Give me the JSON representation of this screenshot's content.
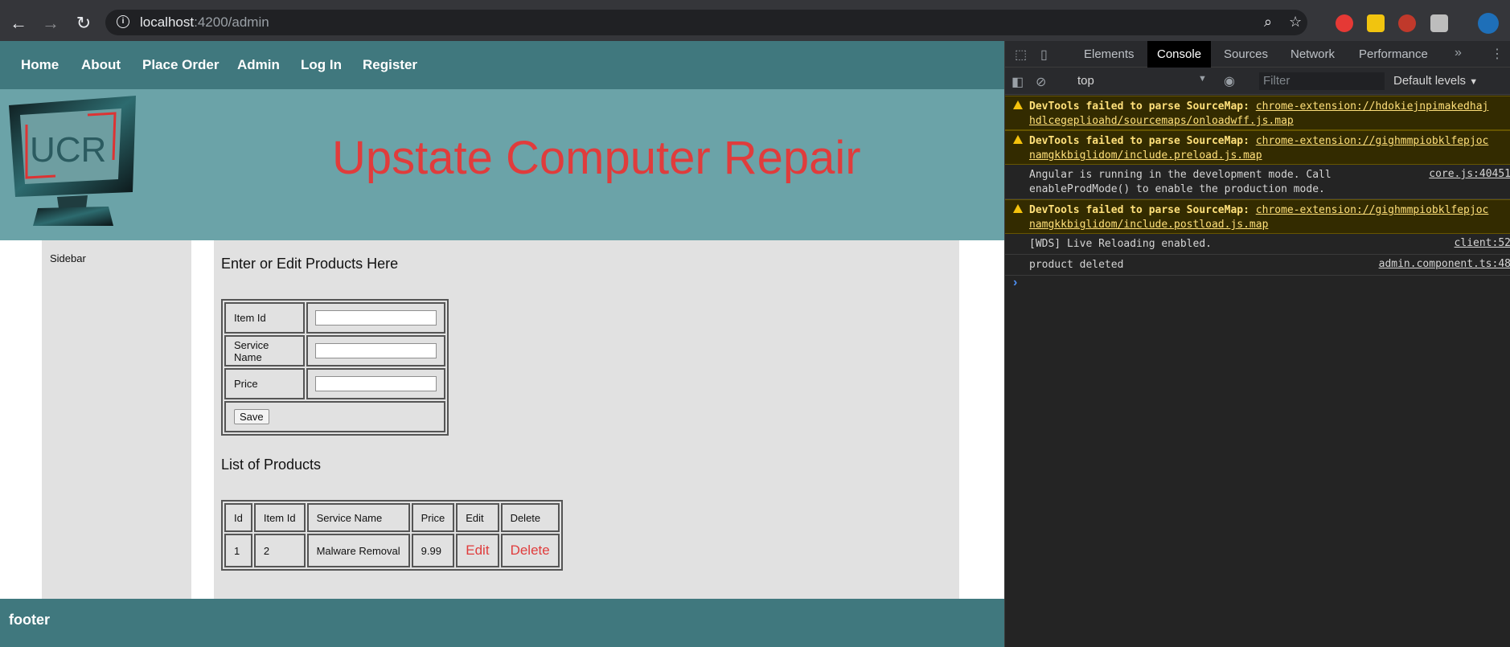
{
  "browser": {
    "url_host": "localhost",
    "url_path": ":4200/admin"
  },
  "nav": {
    "links": [
      "Home",
      "About",
      "Place Order",
      "Admin",
      "Log In",
      "Register"
    ]
  },
  "banner": {
    "logo_text": "UCR",
    "title": "Upstate Computer Repair"
  },
  "sidebar": {
    "label": "Sidebar"
  },
  "form": {
    "heading": "Enter or Edit Products Here",
    "fields": [
      {
        "label": "Item Id",
        "value": ""
      },
      {
        "label": "Service Name",
        "value": ""
      },
      {
        "label": "Price",
        "value": ""
      }
    ],
    "save_label": "Save"
  },
  "list": {
    "heading": "List of Products",
    "columns": [
      "Id",
      "Item Id",
      "Service Name",
      "Price",
      "Edit",
      "Delete"
    ],
    "rows": [
      {
        "id": "1",
        "item_id": "2",
        "service_name": "Malware Removal",
        "price": "9.99",
        "edit": "Edit",
        "delete": "Delete"
      }
    ]
  },
  "footer": {
    "text": "footer"
  },
  "devtools": {
    "tabs": [
      "Elements",
      "Console",
      "Sources",
      "Network",
      "Performance"
    ],
    "active_tab": "Console",
    "context": "top",
    "filter_placeholder": "Filter",
    "levels": "Default levels",
    "messages": [
      {
        "type": "warning",
        "line1_prefix": "DevTools failed to parse SourceMap: ",
        "line1_link": "chrome-extension://hdokiejnpimakedhaj",
        "line2": "hdlcegeplioahd/sourcemaps/onloadwff.js.map",
        "source": ""
      },
      {
        "type": "warning",
        "line1_prefix": "DevTools failed to parse SourceMap: ",
        "line1_link": "chrome-extension://gighmmpiobklfepjoc",
        "line2": "namgkkbiglidom/include.preload.js.map",
        "source": ""
      },
      {
        "type": "log",
        "line1_prefix": "Angular is running in the development mode. Call",
        "line1_link": "",
        "line2": "enableProdMode() to enable the production mode.",
        "source": "core.js:40451"
      },
      {
        "type": "warning",
        "line1_prefix": "DevTools failed to parse SourceMap: ",
        "line1_link": "chrome-extension://gighmmpiobklfepjoc",
        "line2": "namgkkbiglidom/include.postload.js.map",
        "source": ""
      },
      {
        "type": "log",
        "line1_prefix": "[WDS] Live Reloading enabled.",
        "line1_link": "",
        "line2": "",
        "source": "client:52"
      },
      {
        "type": "log",
        "line1_prefix": "product deleted",
        "line1_link": "",
        "line2": "",
        "source": "admin.component.ts:48"
      }
    ],
    "prompt": "›"
  },
  "colors": {
    "navbar": "#40787e",
    "banner": "#6ba3a8",
    "title_red": "#e03c3c",
    "panel_gray": "#e1e1e1"
  }
}
